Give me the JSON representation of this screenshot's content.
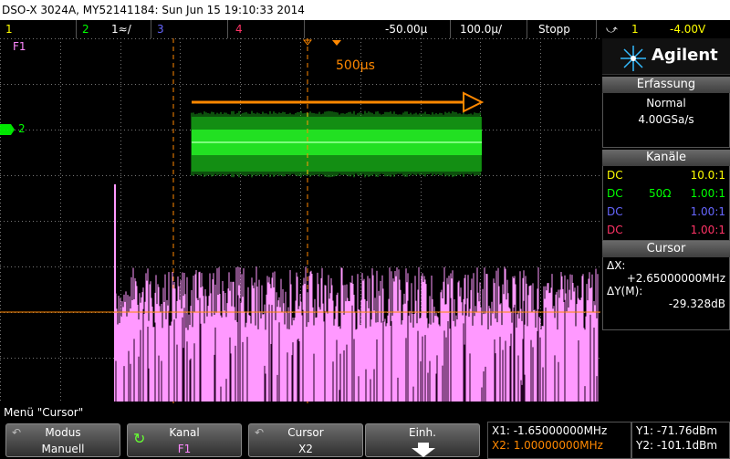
{
  "titlebar": {
    "text": "DSO-X 3024A, MY52141184: Sun Jun 15 19:10:33 2014"
  },
  "channels": {
    "ch1": "1",
    "ch2": "2",
    "ch2_setting": "1≈/",
    "ch3": "3",
    "ch4": "4",
    "time_offset": "-50.00µ",
    "timebase": "100.0µ/",
    "run_state": "Stopp",
    "trigger_source": "1",
    "trigger_level": "-4.00V"
  },
  "colors": {
    "ch1": "#ffff00",
    "ch2": "#00ff00",
    "ch3": "#6666ff",
    "ch4": "#ff3366",
    "math": "#ff88ff",
    "cursor": "#ff8800",
    "grid": "#555555"
  },
  "screen": {
    "marker_f1": "F1",
    "marker_2": "2",
    "span_label": "500µs",
    "f1_spectrum_profile": [
      0.01,
      0.32,
      0.12,
      0.5,
      0.02,
      0.04,
      0.95,
      0.35,
      0.22,
      0.65
    ]
  },
  "sidebar": {
    "logo": "Agilent",
    "acq_header": "Erfassung",
    "acq_mode": "Normal",
    "acq_rate": "4.00GSa/s",
    "chan_header": "Kanäle",
    "channel_rows": [
      {
        "coupling": "DC",
        "impedance": "",
        "ratio": "10.0:1",
        "color": "#ffff00"
      },
      {
        "coupling": "DC",
        "impedance": "50Ω",
        "ratio": "1.00:1",
        "color": "#00ff00"
      },
      {
        "coupling": "DC",
        "impedance": "",
        "ratio": "1.00:1",
        "color": "#6666ff"
      },
      {
        "coupling": "DC",
        "impedance": "",
        "ratio": "1.00:1",
        "color": "#ff3366"
      }
    ],
    "cursor_header": "Cursor",
    "dx_label": "ΔX:",
    "dx_value": "+2.65000000MHz",
    "dy_label": "ΔY(M):",
    "dy_value": "-29.328dB"
  },
  "menu": {
    "title": "Menü \"Cursor\""
  },
  "softkeys": [
    {
      "label": "Modus",
      "value": "Manuell"
    },
    {
      "label": "Kanal",
      "value": "F1"
    },
    {
      "label": "Cursor",
      "value": "X2"
    },
    {
      "label": "Einh.",
      "value": ""
    }
  ],
  "readouts": {
    "x1": "X1: -1.65000000MHz",
    "x2": "X2: 1.00000000MHz",
    "y1": "Y1: -71.76dBm",
    "y2": "Y2: -101.1dBm"
  }
}
